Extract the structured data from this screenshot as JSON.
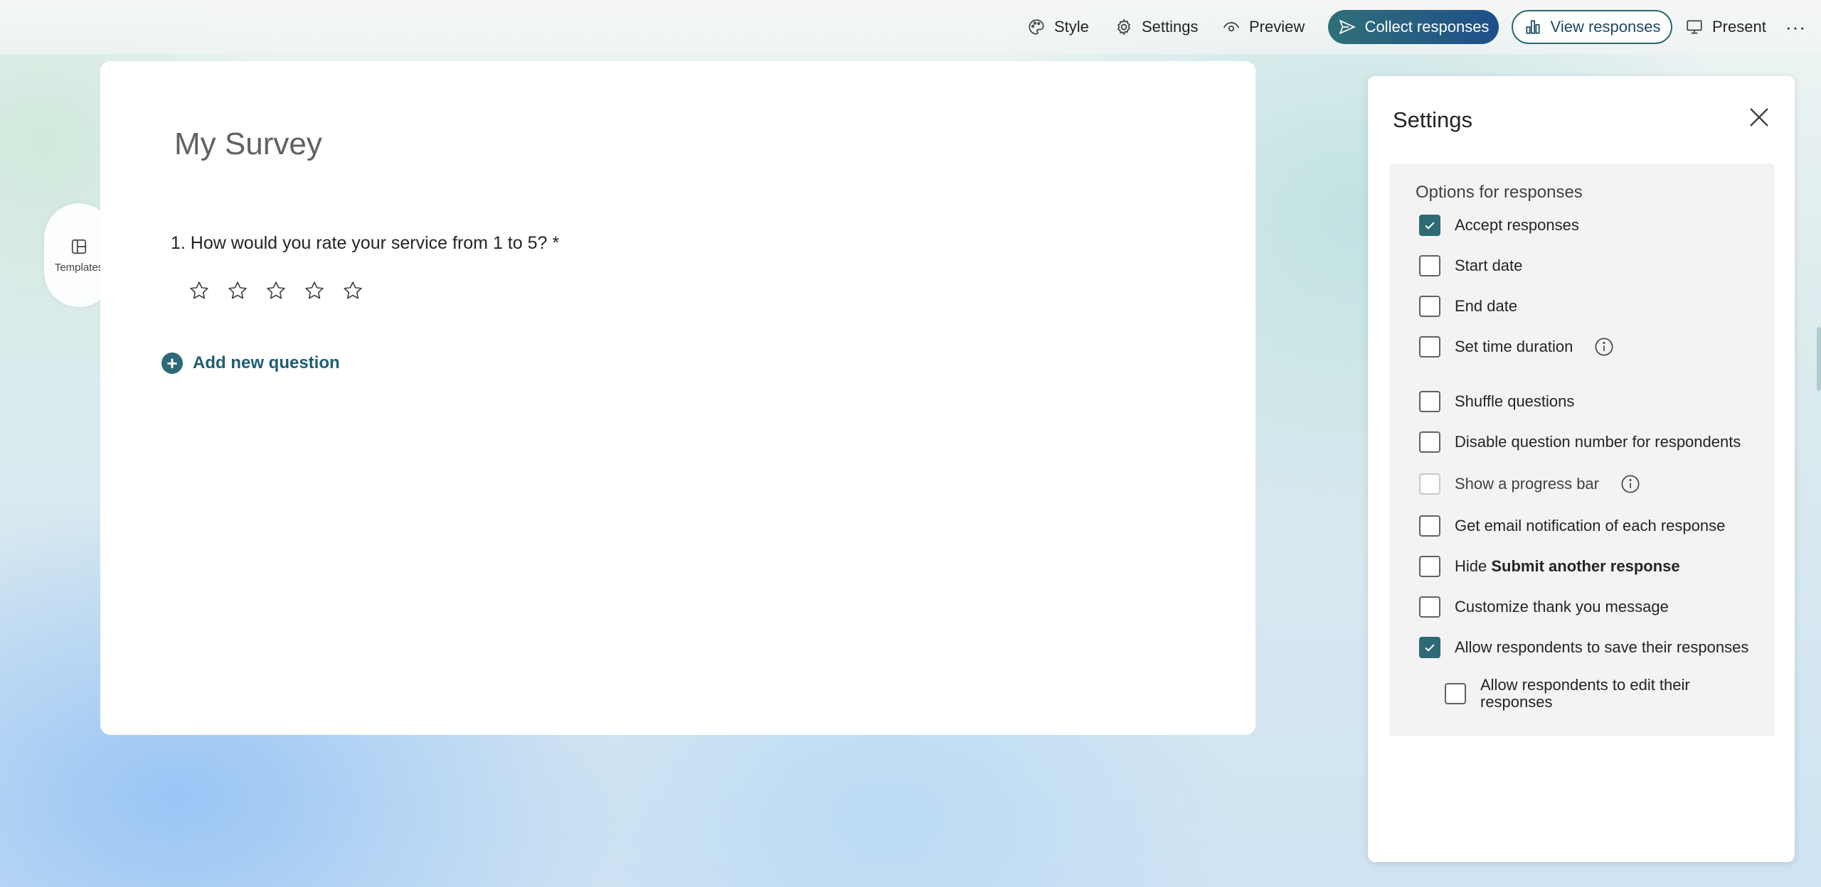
{
  "toolbar": {
    "style": "Style",
    "settings": "Settings",
    "preview": "Preview",
    "collect": "Collect responses",
    "view": "View responses",
    "present": "Present",
    "more": "···"
  },
  "side": {
    "templates": "Templates"
  },
  "form": {
    "title": "My Survey",
    "question": "1. How would you rate your service from 1 to 5? *",
    "rating_max": 5,
    "add_question": "Add new question"
  },
  "settings_panel": {
    "title": "Settings",
    "section_title": "Options for responses",
    "options": [
      {
        "label": "Accept responses",
        "checked": true
      },
      {
        "label": "Start date",
        "checked": false
      },
      {
        "label": "End date",
        "checked": false
      },
      {
        "label": "Set time duration",
        "checked": false,
        "info": true
      },
      {
        "label": "Shuffle questions",
        "checked": false
      },
      {
        "label": "Disable question number for respondents",
        "checked": false
      },
      {
        "label": "Show a progress bar",
        "checked": false,
        "disabled": true,
        "info": true
      },
      {
        "label": "Get email notification of each response",
        "checked": false
      },
      {
        "label_prefix": "Hide ",
        "label_bold": "Submit another response",
        "checked": false
      },
      {
        "label": "Customize thank you message",
        "checked": false
      },
      {
        "label": "Allow respondents to save their responses",
        "checked": true
      },
      {
        "label": "Allow respondents to edit their responses",
        "checked": false,
        "nested": true
      }
    ]
  },
  "colors": {
    "accent": "#2d6a75",
    "collect_gradient_end": "#1f4f8a"
  }
}
